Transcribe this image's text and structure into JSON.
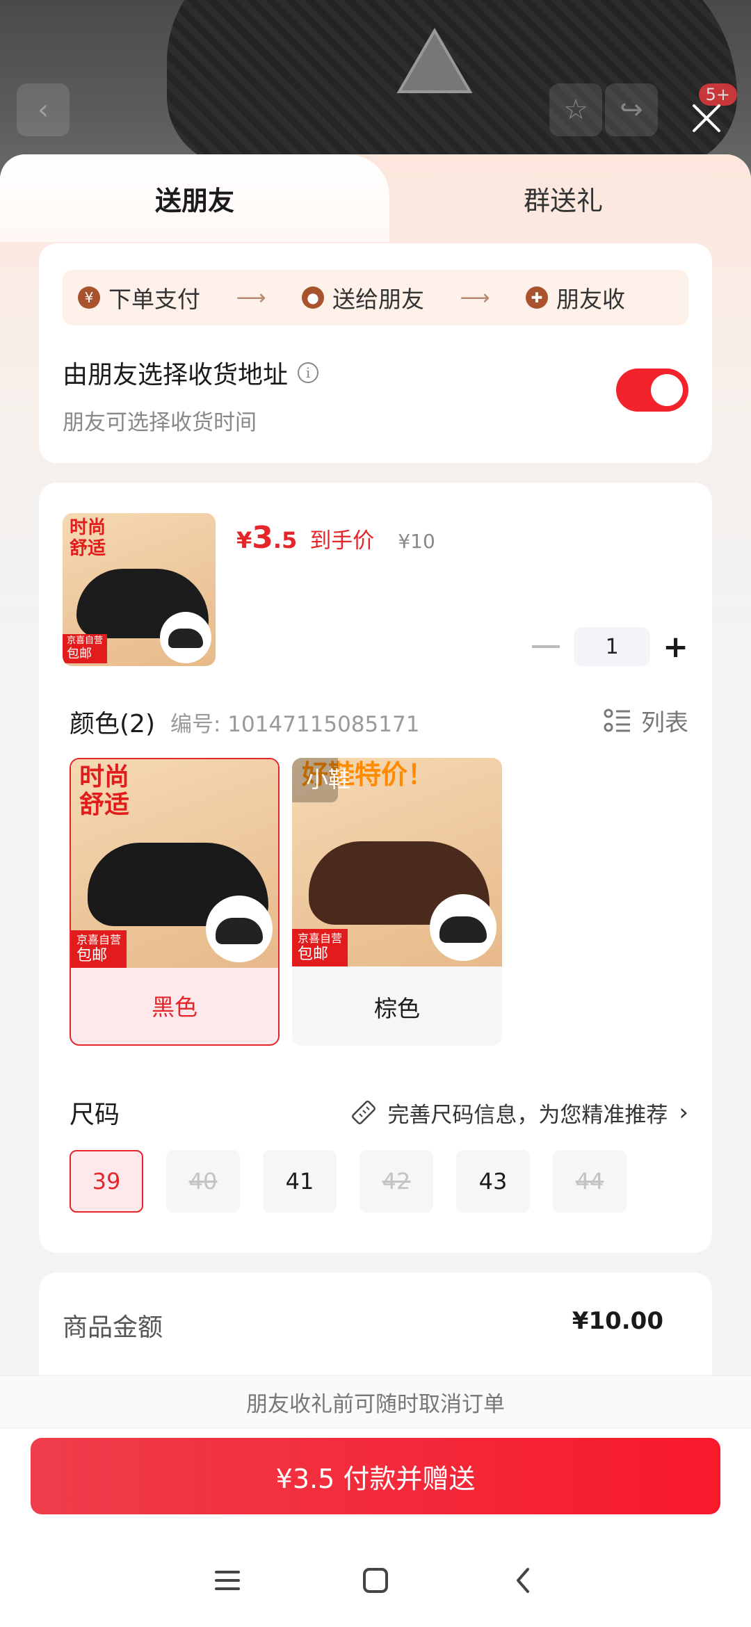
{
  "top_bar": {
    "badge": "5+"
  },
  "tabs": [
    {
      "label": "送朋友"
    },
    {
      "label": "群送礼"
    }
  ],
  "flow": {
    "steps": [
      {
        "icon": "yen-circle-icon",
        "label": "下单支付"
      },
      {
        "icon": "wechat-circle-icon",
        "label": "送给朋友"
      },
      {
        "icon": "gift-circle-icon",
        "label": "朋友收"
      }
    ]
  },
  "address_option": {
    "title": "由朋友选择收货地址",
    "subtitle": "朋友可选择收货时间",
    "enabled": true
  },
  "product": {
    "thumb_text_line1": "时尚",
    "thumb_text_line2": "舒适",
    "thumb_tag_line1": "京喜自营",
    "thumb_tag_line2": "包邮",
    "price_symbol": "¥",
    "price_int": "3",
    "price_dec": ".5",
    "price_label": "到手价",
    "original_price": "¥10",
    "quantity": "1"
  },
  "color_section": {
    "title": "颜色(2)",
    "sku": "编号: 10147115085171",
    "list_label": "列表",
    "options": [
      {
        "label": "黑色",
        "selected": true,
        "img_text_line1": "时尚",
        "img_text_line2": "舒适",
        "tag_line1": "京喜自营",
        "tag_line2": "包邮"
      },
      {
        "label": "棕色",
        "selected": false,
        "img_text": "好鞋特价！",
        "overlay_text": "小鞋",
        "tag_line1": "京喜自营",
        "tag_line2": "包邮"
      }
    ]
  },
  "size_section": {
    "title": "尺码",
    "hint": "完善尺码信息，为您精准推荐",
    "sizes": [
      {
        "label": "39",
        "state": "selected"
      },
      {
        "label": "40",
        "state": "disabled"
      },
      {
        "label": "41",
        "state": "normal"
      },
      {
        "label": "42",
        "state": "disabled"
      },
      {
        "label": "43",
        "state": "normal"
      },
      {
        "label": "44",
        "state": "disabled"
      }
    ]
  },
  "summary": {
    "label": "商品金额",
    "value": "¥10.00"
  },
  "footer": {
    "note": "朋友收礼前可随时取消订单",
    "pay_button": "¥3.5 付款并赠送"
  },
  "colors": {
    "accent": "#e4262b",
    "toggle_on": "#f3232d"
  }
}
